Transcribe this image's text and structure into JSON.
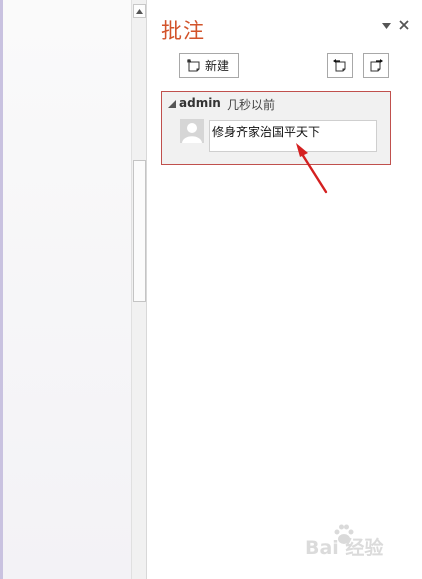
{
  "pane": {
    "title": "批注",
    "new_button_label": "新建"
  },
  "comment": {
    "author": "admin",
    "time": "几秒以前",
    "text": "修身齐家治国平天下"
  },
  "watermark": {
    "text": "Bai 经验"
  },
  "colors": {
    "title_accent": "#d2532a",
    "active_comment_border": "#c0504d",
    "annotation_arrow": "#d42020"
  },
  "icons": {
    "options": "triangle-down-icon",
    "close": "close-icon",
    "new_comment": "new-comment-icon",
    "previous": "previous-comment-icon",
    "next": "next-comment-icon",
    "avatar": "user-avatar-icon",
    "collapse": "collapse-triangle-icon",
    "scroll_up": "scroll-up-arrow-icon"
  }
}
